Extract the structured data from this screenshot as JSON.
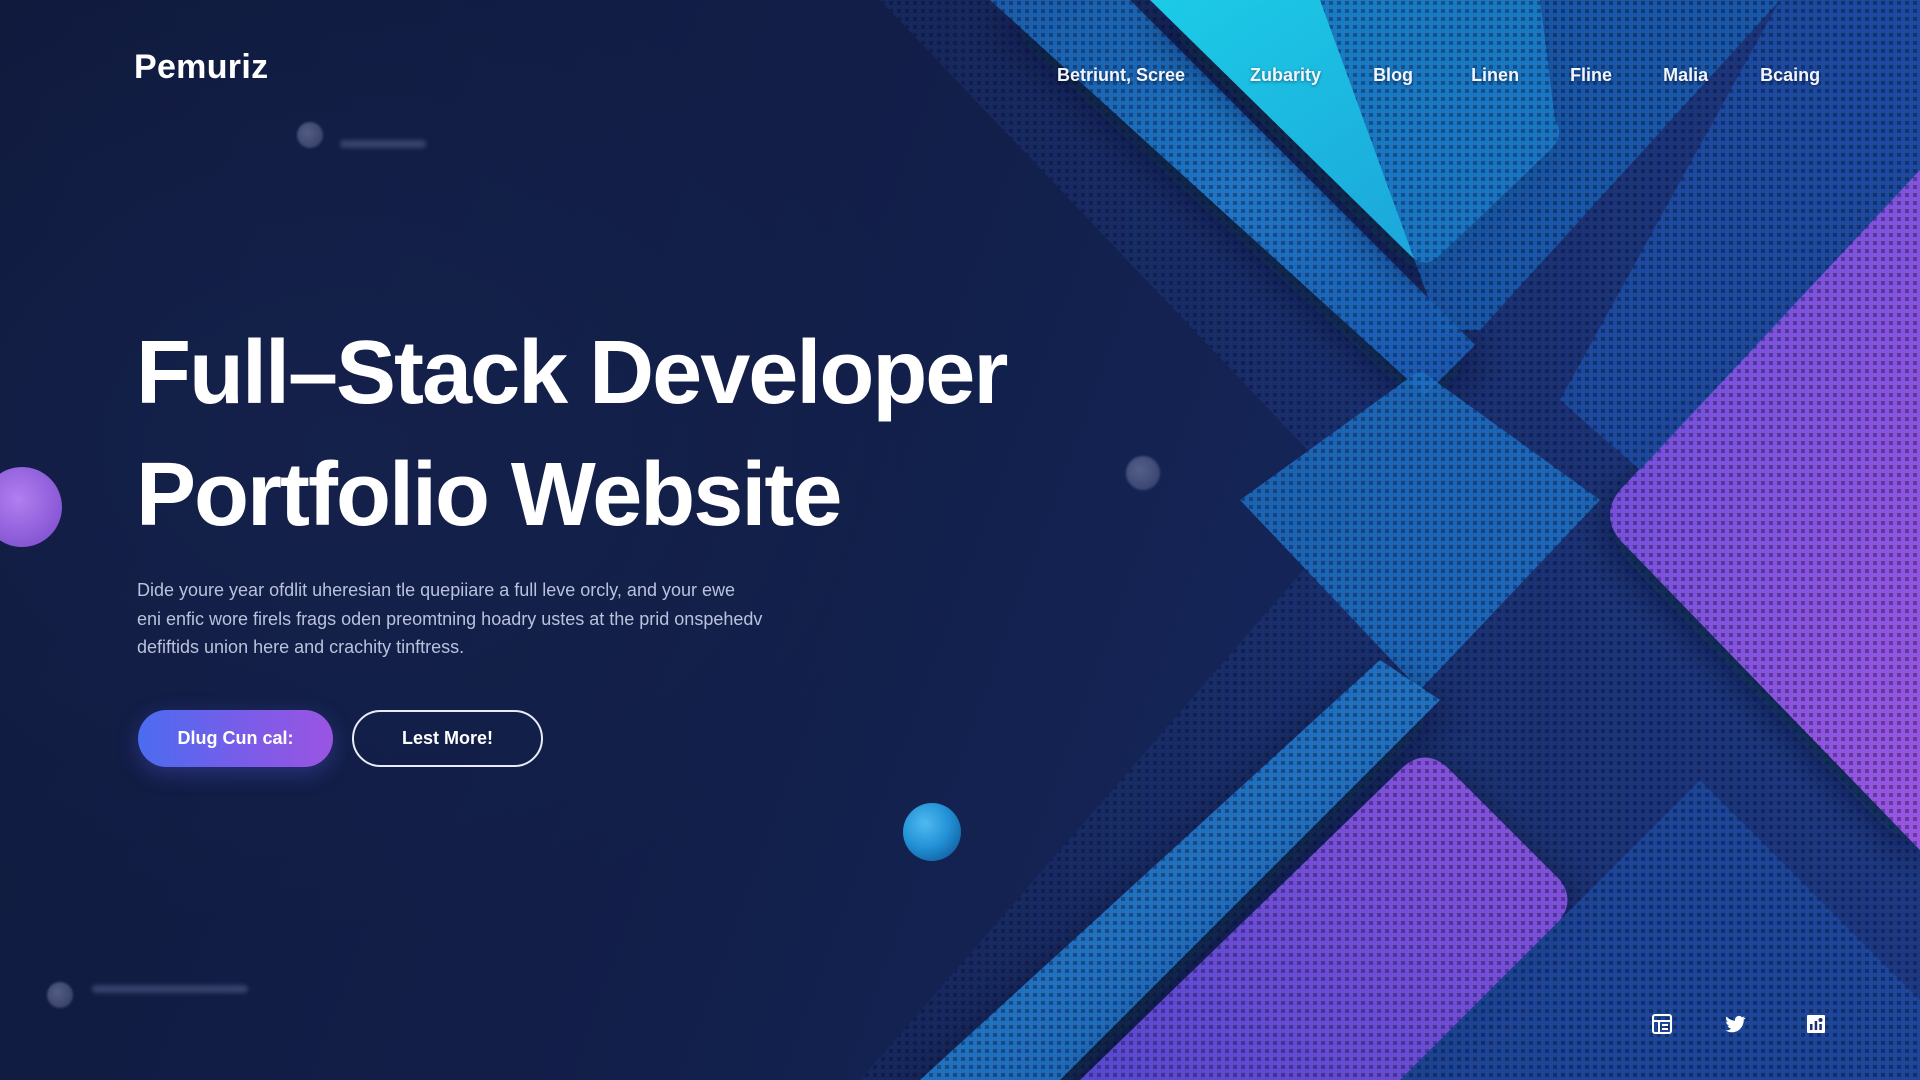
{
  "brand": {
    "logo_text": "Pemuriz"
  },
  "nav": {
    "items": [
      {
        "label": "Betriunt, Scree"
      },
      {
        "label": "Zubarity"
      },
      {
        "label": "Blog"
      },
      {
        "label": "Linen"
      },
      {
        "label": "Fline"
      },
      {
        "label": "Malia"
      },
      {
        "label": "Bcaing"
      }
    ]
  },
  "hero": {
    "title_line_1": "Full–Stack Developer",
    "title_line_2": "Portfolio  Website",
    "description_line_1": "Dide youre year ofdlit uheresian tle quepiiare a full leve orcly, and your ewe",
    "description_line_2": "eni enfic wore firels frags oden preomtning hoadry ustes at the prid onspehedv",
    "description_line_3": "defiftids union here and crachity tinftress.",
    "primary_button_label": "Dlug Cun cal:",
    "secondary_button_label": "Lest More!"
  },
  "social": {
    "icons": [
      "profile-card-icon",
      "twitter-icon",
      "analytics-icon"
    ]
  },
  "colors": {
    "background": "#101a3d",
    "accent_cyan": "#21b6e0",
    "accent_blue": "#2b63c8",
    "accent_purple": "#8a52db",
    "button_gradient_start": "#4b6cf0",
    "button_gradient_end": "#9a55e2",
    "text_primary": "#ffffff",
    "text_secondary": "#b9c2dc"
  }
}
